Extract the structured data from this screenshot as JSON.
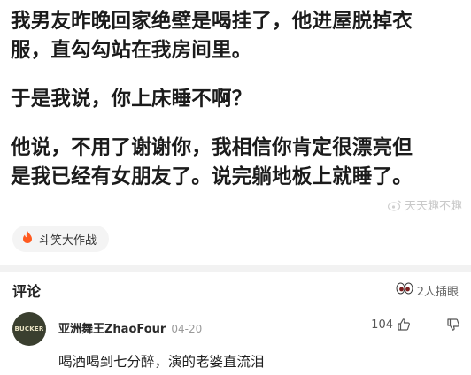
{
  "post": {
    "lines": [
      "我男友昨晚回家绝壁是喝挂了，他进屋脱掉衣",
      "服，直勾勾站在我房间里。",
      "于是我说，你上床睡不啊？",
      "他说，不用了谢谢你，我相信你肯定很漂亮但",
      "是我已经有女朋友了。说完躺地板上就睡了。"
    ],
    "watermark": "天天趣不趣"
  },
  "topic": {
    "label": "斗笑大作战",
    "icon": "fire-icon"
  },
  "comments_section": {
    "title": "评论",
    "participants": "2人插眼"
  },
  "comments": [
    {
      "author": "亚洲舞王ZhaoFour",
      "date": "04-20",
      "avatar_text": "BUCKER",
      "likes": "104",
      "text": "喝酒喝到七分醉，演的老婆直流泪"
    }
  ],
  "colors": {
    "fire": "#ff5a1f",
    "divider": "#f2f2f2"
  }
}
